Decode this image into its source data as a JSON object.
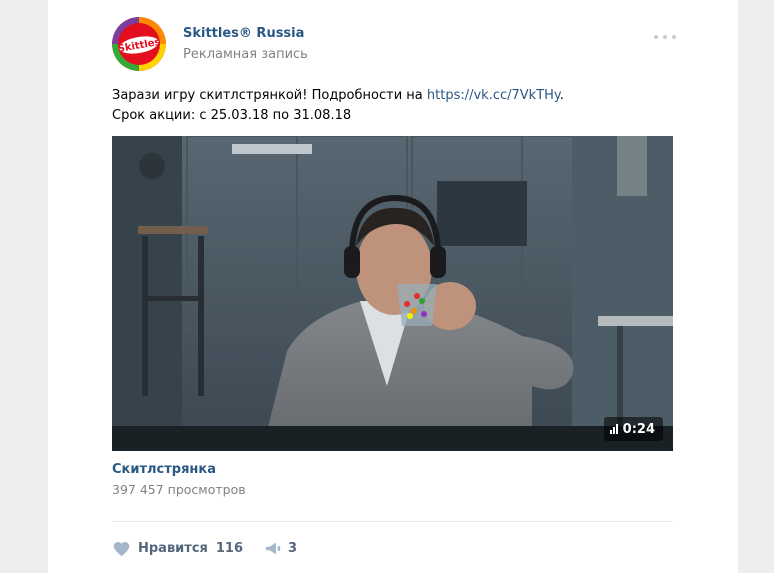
{
  "post": {
    "author": "Skittles® Russia",
    "subtitle": "Рекламная запись",
    "avatar_logo_text": "Skittles",
    "text_line1_before": "Зарази игру скитлстрянкой! Подробности на ",
    "text_link": "https://vk.cc/7VkTHy",
    "text_line1_after": ".",
    "text_line2": "Срок акции: с 25.03.18 по 31.08.18"
  },
  "video": {
    "duration": "0:24",
    "title": "Скитлстрянка",
    "views": "397 457 просмотров"
  },
  "actions": {
    "like_label": "Нравится",
    "like_count": "116",
    "share_count": "3"
  },
  "icons": {
    "like": "heart-icon",
    "share": "megaphone-icon",
    "more": "more-icon",
    "duration": "bars-icon"
  },
  "colors": {
    "link": "#2a5885",
    "secondary_text": "#828282",
    "action_text": "#55677d",
    "icon": "#a6b6c9",
    "background": "#edeef0"
  }
}
